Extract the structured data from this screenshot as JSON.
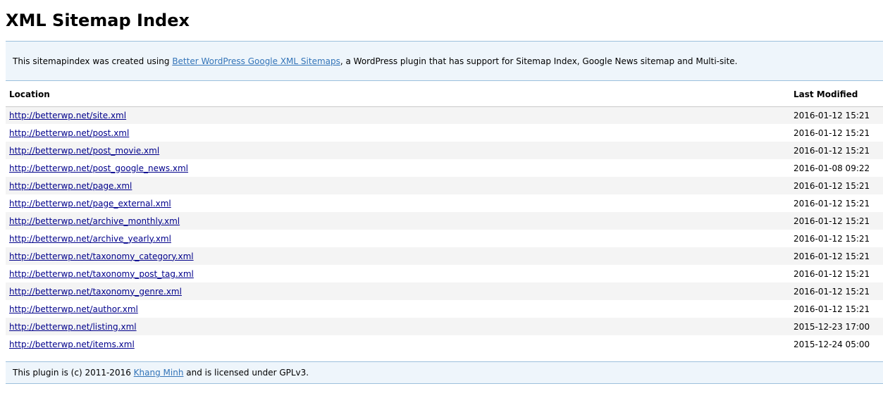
{
  "title": "XML Sitemap Index",
  "intro": {
    "before": "This sitemapindex was created using ",
    "link": "Better WordPress Google XML Sitemaps",
    "after": ", a WordPress plugin that has support for Sitemap Index, Google News sitemap and Multi-site."
  },
  "table": {
    "headers": {
      "location": "Location",
      "last_modified": "Last Modified"
    },
    "rows": [
      {
        "location": "http://betterwp.net/site.xml",
        "last_modified": "2016-01-12 15:21"
      },
      {
        "location": "http://betterwp.net/post.xml",
        "last_modified": "2016-01-12 15:21"
      },
      {
        "location": "http://betterwp.net/post_movie.xml",
        "last_modified": "2016-01-12 15:21"
      },
      {
        "location": "http://betterwp.net/post_google_news.xml",
        "last_modified": "2016-01-08 09:22"
      },
      {
        "location": "http://betterwp.net/page.xml",
        "last_modified": "2016-01-12 15:21"
      },
      {
        "location": "http://betterwp.net/page_external.xml",
        "last_modified": "2016-01-12 15:21"
      },
      {
        "location": "http://betterwp.net/archive_monthly.xml",
        "last_modified": "2016-01-12 15:21"
      },
      {
        "location": "http://betterwp.net/archive_yearly.xml",
        "last_modified": "2016-01-12 15:21"
      },
      {
        "location": "http://betterwp.net/taxonomy_category.xml",
        "last_modified": "2016-01-12 15:21"
      },
      {
        "location": "http://betterwp.net/taxonomy_post_tag.xml",
        "last_modified": "2016-01-12 15:21"
      },
      {
        "location": "http://betterwp.net/taxonomy_genre.xml",
        "last_modified": "2016-01-12 15:21"
      },
      {
        "location": "http://betterwp.net/author.xml",
        "last_modified": "2016-01-12 15:21"
      },
      {
        "location": "http://betterwp.net/listing.xml",
        "last_modified": "2015-12-23 17:00"
      },
      {
        "location": "http://betterwp.net/items.xml",
        "last_modified": "2015-12-24 05:00"
      }
    ]
  },
  "footer": {
    "before": "This plugin is (c) 2011-2016 ",
    "link": "Khang Minh",
    "after": " and is licensed under GPLv3."
  },
  "colors": {
    "link": "#3374b8",
    "table_link": "#00008b",
    "box_background": "#eef5fb",
    "box_border": "#9cc0dc",
    "row_alt": "#f4f4f4"
  }
}
